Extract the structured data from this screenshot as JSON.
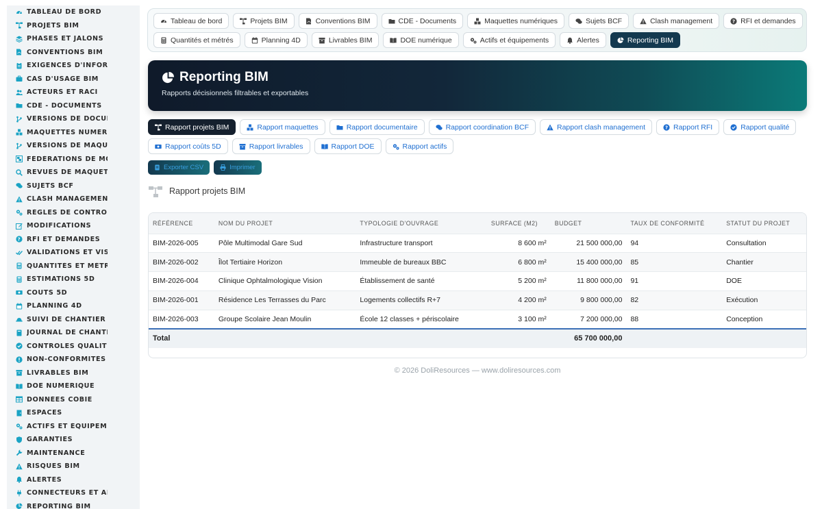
{
  "sidebar": {
    "items": [
      {
        "label": "TABLEAU DE BORD",
        "icon": "gauge-icon"
      },
      {
        "label": "PROJETS BIM",
        "icon": "sitemap-icon"
      },
      {
        "label": "PHASES ET JALONS",
        "icon": "layers-icon"
      },
      {
        "label": "CONVENTIONS BIM",
        "icon": "file-signature-icon"
      },
      {
        "label": "EXIGENCES D'INFORMATI",
        "icon": "clipboard-icon"
      },
      {
        "label": "CAS D'USAGE BIM",
        "icon": "briefcase-icon"
      },
      {
        "label": "ACTEURS ET RACI",
        "icon": "users-icon"
      },
      {
        "label": "CDE - DOCUMENTS",
        "icon": "folder-icon"
      },
      {
        "label": "VERSIONS DE DOCUMEN",
        "icon": "branch-icon"
      },
      {
        "label": "MAQUETTES NUMÉRIQU",
        "icon": "cubes-icon"
      },
      {
        "label": "VERSIONS DE MAQUETT",
        "icon": "branch-icon"
      },
      {
        "label": "FÉDÉRATIONS DE MODÈ",
        "icon": "object-group-icon"
      },
      {
        "label": "REVUES DE MAQUETTES",
        "icon": "search-icon"
      },
      {
        "label": "SUJETS BCF",
        "icon": "comments-icon"
      },
      {
        "label": "CLASH MANAGEMENT",
        "icon": "warning-icon"
      },
      {
        "label": "RÈGLES DE CONTRÔLE",
        "icon": "cogs-icon"
      },
      {
        "label": "MODIFICATIONS",
        "icon": "edit-icon"
      },
      {
        "label": "RFI ET DEMANDES",
        "icon": "question-icon"
      },
      {
        "label": "VALIDATIONS ET VISAS",
        "icon": "check-double-icon"
      },
      {
        "label": "QUANTITÉS ET MÉTRÉS",
        "icon": "calculator-icon"
      },
      {
        "label": "ESTIMATIONS 5D",
        "icon": "calculator-icon"
      },
      {
        "label": "COÛTS 5D",
        "icon": "money-icon"
      },
      {
        "label": "PLANNING 4D",
        "icon": "calendar-icon"
      },
      {
        "label": "SUIVI DE CHANTIER",
        "icon": "hard-hat-icon"
      },
      {
        "label": "JOURNAL DE CHANTIER",
        "icon": "book-icon"
      },
      {
        "label": "CONTRÔLES QUALITÉ",
        "icon": "check-circle-icon"
      },
      {
        "label": "NON-CONFORMITÉS",
        "icon": "exclamation-icon"
      },
      {
        "label": "LIVRABLES BIM",
        "icon": "box-icon"
      },
      {
        "label": "DOE NUMÉRIQUE",
        "icon": "book-open-icon"
      },
      {
        "label": "DONNÉES COBIE",
        "icon": "table-icon"
      },
      {
        "label": "ESPACES",
        "icon": "door-icon"
      },
      {
        "label": "ACTIFS ET ÉQUIPEMENT",
        "icon": "cogs-icon"
      },
      {
        "label": "GARANTIES",
        "icon": "shield-icon"
      },
      {
        "label": "MAINTENANCE",
        "icon": "wrench-icon"
      },
      {
        "label": "RISQUES BIM",
        "icon": "warning-icon"
      },
      {
        "label": "ALERTES",
        "icon": "bell-icon"
      },
      {
        "label": "CONNECTEURS ET API",
        "icon": "plug-icon"
      },
      {
        "label": "REPORTING BIM",
        "icon": "chart-pie-icon"
      }
    ]
  },
  "topnav": {
    "row1": [
      {
        "label": "Tableau de bord",
        "icon": "gauge-icon"
      },
      {
        "label": "Projets BIM",
        "icon": "sitemap-icon"
      },
      {
        "label": "Conventions BIM",
        "icon": "file-signature-icon"
      },
      {
        "label": "CDE - Documents",
        "icon": "folder-icon"
      },
      {
        "label": "Maquettes numériques",
        "icon": "cubes-icon"
      },
      {
        "label": "Sujets BCF",
        "icon": "comments-icon"
      },
      {
        "label": "Clash management",
        "icon": "warning-icon"
      },
      {
        "label": "RFI et demandes",
        "icon": "question-icon"
      }
    ],
    "row2": [
      {
        "label": "Quantités et métrés",
        "icon": "calculator-icon"
      },
      {
        "label": "Planning 4D",
        "icon": "calendar-icon"
      },
      {
        "label": "Livrables BIM",
        "icon": "box-icon"
      },
      {
        "label": "DOE numérique",
        "icon": "book-open-icon"
      },
      {
        "label": "Actifs et équipements",
        "icon": "cogs-icon"
      },
      {
        "label": "Alertes",
        "icon": "bell-icon"
      },
      {
        "label": "Reporting BIM",
        "icon": "chart-pie-icon",
        "active": true
      }
    ]
  },
  "hero": {
    "title": "Reporting BIM",
    "subtitle": "Rapports décisionnels filtrables et exportables"
  },
  "report_tabs": {
    "row1": [
      {
        "label": "Rapport projets BIM",
        "icon": "sitemap-icon",
        "active": true
      },
      {
        "label": "Rapport maquettes",
        "icon": "cubes-icon"
      },
      {
        "label": "Rapport documentaire",
        "icon": "folder-icon"
      },
      {
        "label": "Rapport coordination BCF",
        "icon": "comments-icon"
      },
      {
        "label": "Rapport clash management",
        "icon": "warning-icon"
      },
      {
        "label": "Rapport RFI",
        "icon": "question-icon"
      },
      {
        "label": "Rapport qualité",
        "icon": "check-circle-icon"
      }
    ],
    "row2": [
      {
        "label": "Rapport coûts 5D",
        "icon": "money-icon"
      },
      {
        "label": "Rapport livrables",
        "icon": "box-icon"
      },
      {
        "label": "Rapport DOE",
        "icon": "book-open-icon"
      },
      {
        "label": "Rapport actifs",
        "icon": "cogs-icon"
      }
    ]
  },
  "actions": {
    "export_label": "Exporter CSV",
    "print_label": "Imprimer"
  },
  "section": {
    "title": "Rapport projets BIM"
  },
  "table": {
    "headers": [
      "RÉFÉRENCE",
      "NOM DU PROJET",
      "TYPOLOGIE D'OUVRAGE",
      "SURFACE (M2)",
      "BUDGET",
      "TAUX DE CONFORMITÉ",
      "STATUT DU PROJET"
    ],
    "rows": [
      [
        "BIM-2026-005",
        "Pôle Multimodal Gare Sud",
        "Infrastructure transport",
        "8 600 m²",
        "21 500 000,00",
        "94",
        "Consultation"
      ],
      [
        "BIM-2026-002",
        "Îlot Tertiaire Horizon",
        "Immeuble de bureaux BBC",
        "6 800 m²",
        "15 400 000,00",
        "85",
        "Chantier"
      ],
      [
        "BIM-2026-004",
        "Clinique Ophtalmologique Vision",
        "Établissement de santé",
        "5 200 m²",
        "11 800 000,00",
        "91",
        "DOE"
      ],
      [
        "BIM-2026-001",
        "Résidence Les Terrasses du Parc",
        "Logements collectifs R+7",
        "4 200 m²",
        "9 800 000,00",
        "82",
        "Exécution"
      ],
      [
        "BIM-2026-003",
        "Groupe Scolaire Jean Moulin",
        "École 12 classes + périscolaire",
        "3 100 m²",
        "7 200 000,00",
        "88",
        "Conception"
      ]
    ],
    "total_label": "Total",
    "total_budget": "65 700 000,00"
  },
  "footer": {
    "text": "© 2026 DoliResources — www.doliresources.com"
  },
  "colors": {
    "accent": "#1f6fd1",
    "sidebar_icon": "#1aa3c4",
    "active_nav": "#13394f"
  }
}
